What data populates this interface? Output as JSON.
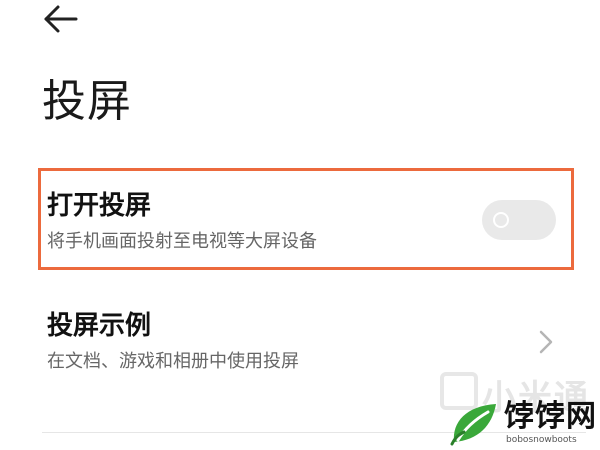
{
  "header": {
    "back_icon": "arrow-left-icon",
    "title": "投屏"
  },
  "settings": {
    "cast_toggle": {
      "title": "打开投屏",
      "subtitle": "将手机画面投射至电视等大屏设备",
      "enabled": false,
      "highlight_color": "#ec6a3d"
    },
    "cast_examples": {
      "title": "投屏示例",
      "subtitle": "在文档、游戏和相册中使用投屏",
      "chevron_icon": "chevron-right-icon"
    }
  },
  "watermark": {
    "text": "小米通"
  },
  "logo": {
    "name": "饽饽网",
    "domain": "bobosnowboots"
  }
}
